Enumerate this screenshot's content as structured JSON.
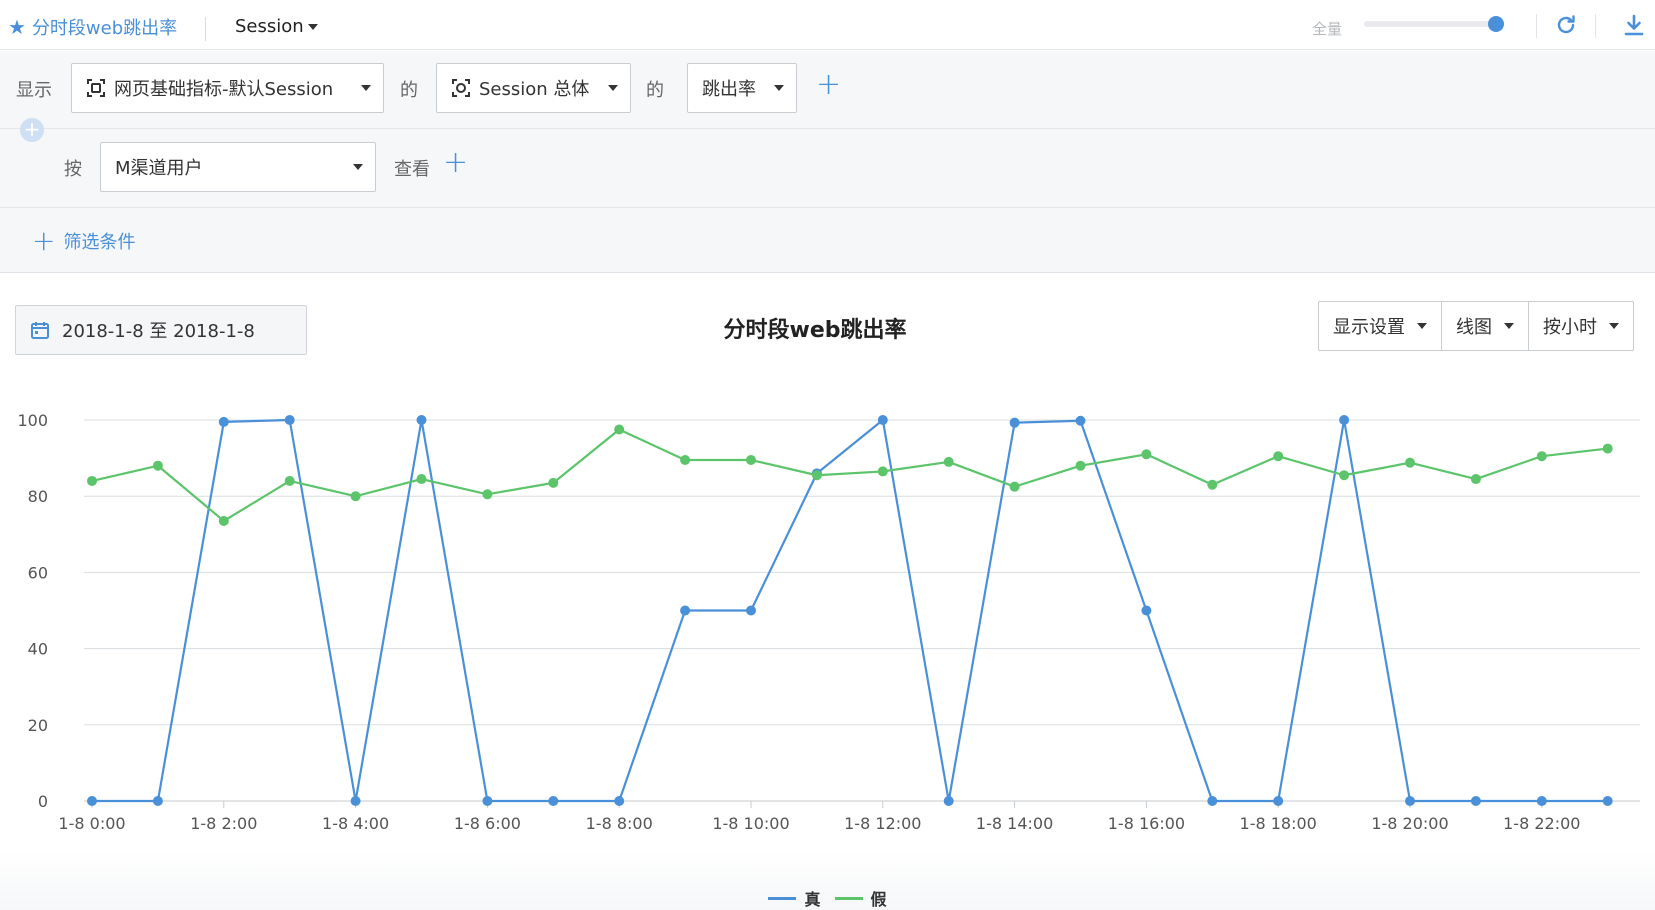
{
  "header": {
    "title": "分时段web跳出率",
    "session_label": "Session",
    "zoom_label": "全量",
    "zoom_level": 0.95
  },
  "query": {
    "show_label": "显示",
    "metric_source": "网页基础指标-默认Session",
    "of_label_1": "的",
    "scope": "Session 总体",
    "of_label_2": "的",
    "metric": "跳出率",
    "by_label": "按",
    "group_by": "M渠道用户",
    "view_label": "查看",
    "filter_label": "筛选条件"
  },
  "toolbar": {
    "date_range": "2018-1-8 至 2018-1-8",
    "chart_title": "分时段web跳出率",
    "display_settings": "显示设置",
    "chart_type": "线图",
    "granularity": "按小时"
  },
  "colors": {
    "accent": "#4a90d9",
    "series_true": "#4a90d9",
    "series_false": "#5cc46a"
  },
  "chart_data": {
    "type": "line",
    "x": [
      "1-8 0:00",
      "1-8 1:00",
      "1-8 2:00",
      "1-8 3:00",
      "1-8 4:00",
      "1-8 5:00",
      "1-8 6:00",
      "1-8 7:00",
      "1-8 8:00",
      "1-8 9:00",
      "1-8 10:00",
      "1-8 11:00",
      "1-8 12:00",
      "1-8 13:00",
      "1-8 14:00",
      "1-8 15:00",
      "1-8 16:00",
      "1-8 17:00",
      "1-8 18:00",
      "1-8 19:00",
      "1-8 20:00",
      "1-8 21:00",
      "1-8 22:00",
      "1-8 23:00"
    ],
    "x_tick_labels": [
      "1-8 0:00",
      "1-8 2:00",
      "1-8 4:00",
      "1-8 6:00",
      "1-8 8:00",
      "1-8 10:00",
      "1-8 12:00",
      "1-8 14:00",
      "1-8 16:00",
      "1-8 18:00",
      "1-8 20:00",
      "1-8 22:00"
    ],
    "y_ticks": [
      0,
      20,
      40,
      60,
      80,
      100
    ],
    "ylim": [
      0,
      100
    ],
    "grid": true,
    "legend_position": "bottom-center",
    "series": [
      {
        "name": "真",
        "color": "#4a90d9",
        "values": [
          0,
          0,
          99.5,
          100,
          0,
          100,
          0,
          0,
          0,
          50,
          50,
          86,
          100,
          0,
          99.3,
          99.8,
          50,
          0,
          0,
          100,
          0,
          0,
          0,
          0
        ]
      },
      {
        "name": "假",
        "color": "#5cc46a",
        "values": [
          84,
          88,
          73.5,
          84,
          80,
          84.5,
          80.5,
          83.5,
          97.5,
          89.5,
          89.5,
          85.5,
          86.5,
          89,
          82.5,
          88,
          91,
          83,
          90.5,
          85.5,
          88.8,
          84.5,
          90.5,
          92.5
        ]
      }
    ]
  }
}
